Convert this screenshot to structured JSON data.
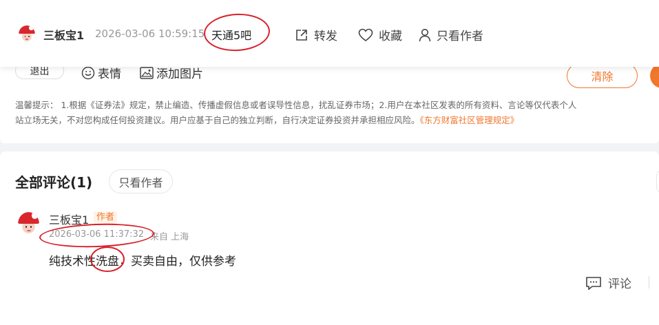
{
  "header": {
    "username": "三板宝1",
    "timestamp": "2026-03-06 10:59:15",
    "bar_name": "天通5吧",
    "actions": {
      "share": "转发",
      "favorite": "收藏",
      "only_author": "只看作者"
    }
  },
  "editor": {
    "logout": "退出",
    "emoji": "表情",
    "add_image": "添加图片",
    "clear": "清除",
    "notice_line1": "温馨提示：  1.根据《证券法》规定，禁止编造、传播虚假信息或者误导性信息，扰乱证券市场；2.用户在本社区发表的所有资料、言论等仅代表个人",
    "notice_line2_prefix": "站立场无关，不对您构成任何投资建议。用户应基于自己的独立判断，自行决定证券投资并承担相应风险。",
    "notice_link": "《东方财富社区管理规定》"
  },
  "comments": {
    "title": "全部评论(1)",
    "only_author": "只看作者",
    "items": [
      {
        "username": "三板宝1",
        "badge": "作者",
        "time": "2026-03-06 11:37:32",
        "location": "来自 上海",
        "text_before": "纯技术性",
        "text_highlight": "洗盘",
        "text_after": "，买卖自由，仅供参考",
        "reply_label": "评论"
      }
    ]
  },
  "colors": {
    "accent": "#f0772c",
    "annotation": "#d8202a"
  }
}
